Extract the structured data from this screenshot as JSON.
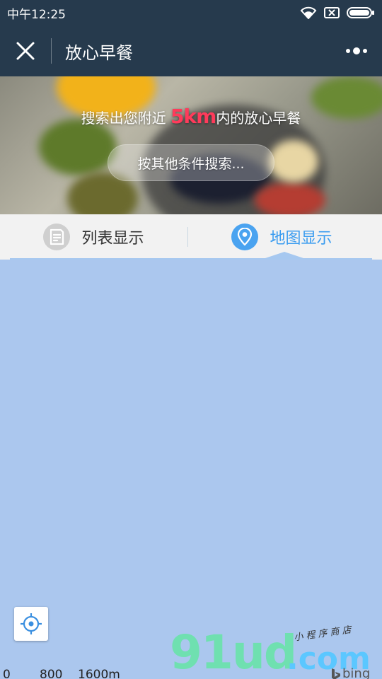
{
  "status_bar": {
    "time": "中午12:25",
    "icons": [
      "wifi-icon",
      "sim-off-icon",
      "battery-icon"
    ]
  },
  "nav_bar": {
    "title": "放心早餐",
    "close_icon": "close-icon",
    "more_icon": "more-dots-icon"
  },
  "banner": {
    "prefix": "搜索出您附近 ",
    "distance": "5km",
    "suffix": "内的放心早餐",
    "search_button": "按其他条件搜索..."
  },
  "tabs": {
    "list_label": "列表显示",
    "map_label": "地图显示",
    "active": "map"
  },
  "map": {
    "scale": [
      "0",
      "800",
      "1600m"
    ],
    "attribution": "bing",
    "watermark": "91ud",
    "watermark_suffix": ".com",
    "watermark_tag": "小 程 序 商 店"
  },
  "colors": {
    "header_bg": "#263a4d",
    "accent": "#3a9cf0",
    "highlight": "#ff3b5b",
    "map_bg": "#abc7ee"
  }
}
